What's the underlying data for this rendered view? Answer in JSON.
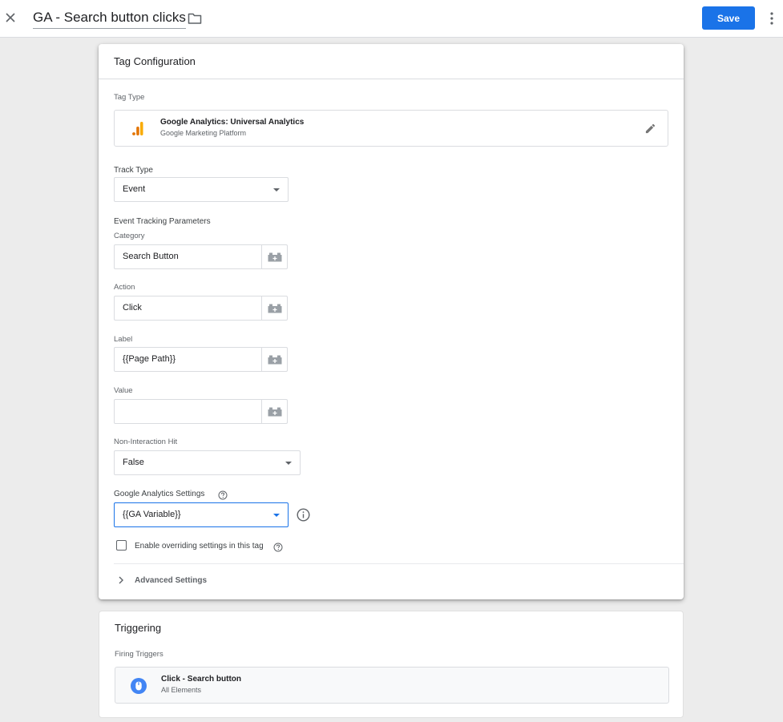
{
  "header": {
    "tag_name": "GA - Search button clicks",
    "save_label": "Save",
    "icons": {
      "close": "close-icon",
      "folder": "folder-icon",
      "more": "more-vert-icon"
    },
    "accent_color": "#1a73e8"
  },
  "tag_configuration": {
    "title": "Tag Configuration",
    "tag_type": {
      "label": "Tag Type",
      "name": "Google Analytics: Universal Analytics",
      "vendor": "Google Marketing Platform",
      "icon": "google-analytics-icon",
      "edit_icon": "pencil-icon"
    },
    "track_type": {
      "label": "Track Type",
      "value": "Event"
    },
    "event_params": {
      "heading": "Event Tracking Parameters",
      "fields": [
        {
          "label": "Category",
          "value": "Search Button"
        },
        {
          "label": "Action",
          "value": "Click"
        },
        {
          "label": "Label",
          "value": "{{Page Path}}"
        },
        {
          "label": "Value",
          "value": ""
        }
      ]
    },
    "non_interaction": {
      "label": "Non-Interaction Hit",
      "value": "False"
    },
    "ga_settings": {
      "label": "Google Analytics Settings",
      "value": "{{GA Variable}}"
    },
    "override_checkbox": {
      "label": "Enable overriding settings in this tag",
      "checked": false
    },
    "advanced_label": "Advanced Settings"
  },
  "triggering": {
    "title": "Triggering",
    "firing_label": "Firing Triggers",
    "trigger": {
      "name": "Click - Search button",
      "sub": "All Elements",
      "icon": "click-trigger-icon",
      "color": "#4285f4"
    }
  }
}
